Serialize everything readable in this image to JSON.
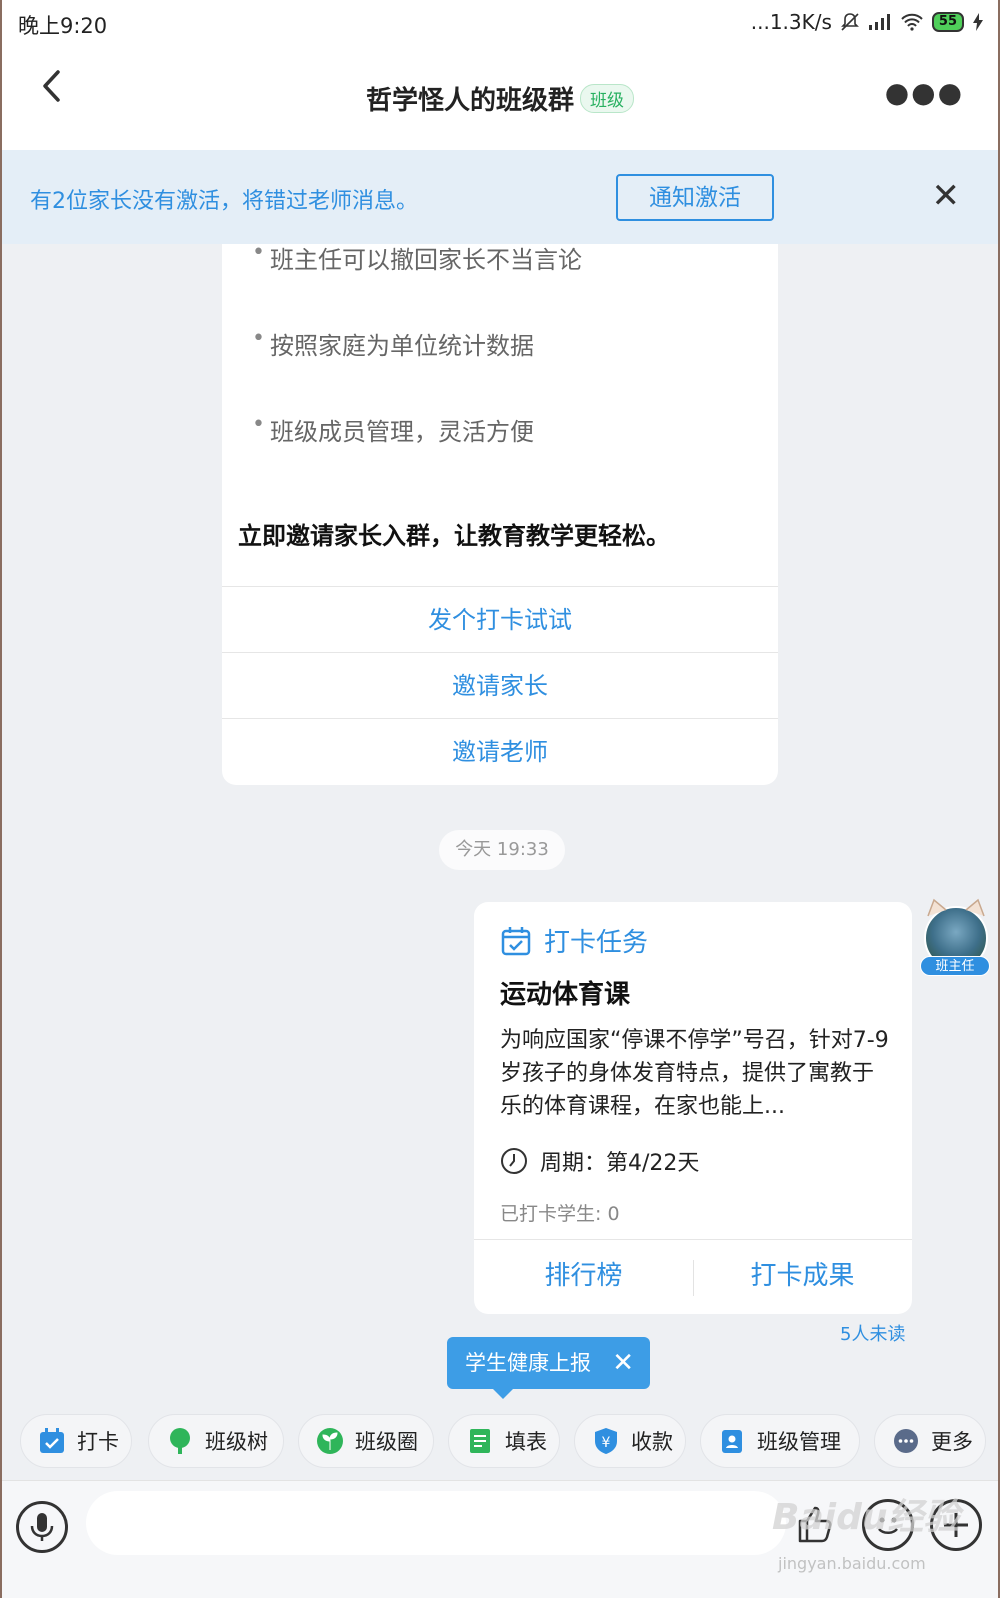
{
  "status_bar": {
    "time": "晚上9:20",
    "network_speed": "...1.3K/s",
    "battery": "55"
  },
  "header": {
    "title": "哲学怪人的班级群",
    "tag": "班级"
  },
  "notice": {
    "text": "有2位家长没有激活，将错过老师消息。",
    "button": "通知激活"
  },
  "intro_card": {
    "bullets": [
      "班主任可以撤回家长不当言论",
      "按照家庭为单位统计数据",
      "班级成员管理，灵活方便"
    ],
    "invite_text": "立即邀请家长入群，让教育教学更轻松。",
    "actions": [
      "发个打卡试试",
      "邀请家长",
      "邀请老师"
    ]
  },
  "timestamp": "今天 19:33",
  "sender": {
    "badge": "班主任"
  },
  "task_card": {
    "label": "打卡任务",
    "title": "运动体育课",
    "description": "为响应国家“停课不停学”号召，针对7-9岁孩子的身体发育特点，提供了寓教于乐的体育课程，在家也能上...",
    "cycle": "周期：第4/22天",
    "checked": "已打卡学生: 0",
    "buttons": [
      "排行榜",
      "打卡成果"
    ]
  },
  "unread": "5人未读",
  "health_popup": "学生健康上报",
  "toolbar": [
    "打卡",
    "班级树",
    "班级圈",
    "填表",
    "收款",
    "班级管理",
    "更多"
  ],
  "watermark": {
    "logo": "Baidu经验",
    "url": "jingyan.baidu.com"
  },
  "colors": {
    "accent": "#2f8fe0",
    "tag_green": "#28b061",
    "background": "#eef0f3"
  }
}
